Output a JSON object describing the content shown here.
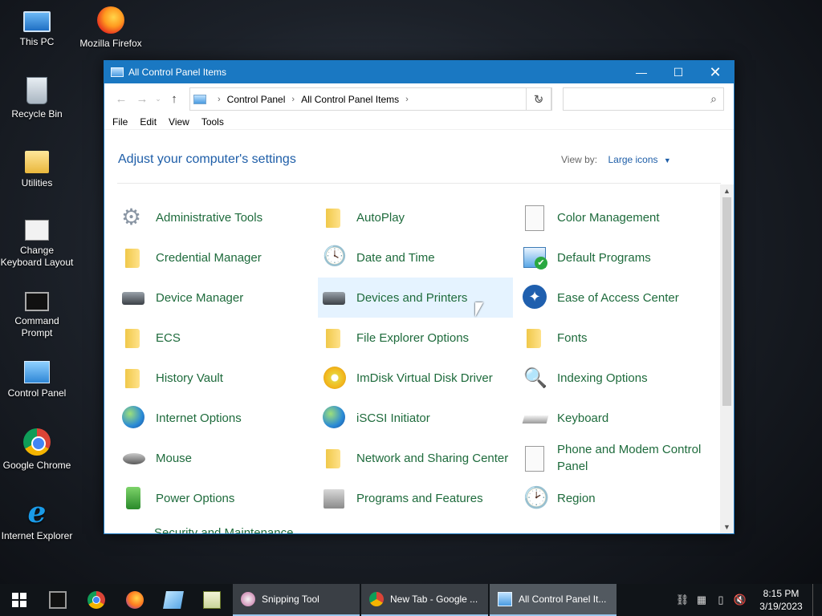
{
  "desktop": {
    "icons": [
      {
        "label": "This PC"
      },
      {
        "label": "Mozilla Firefox"
      },
      {
        "label": "Recycle Bin"
      },
      {
        "label": "Utilities"
      },
      {
        "label": "Change Keyboard Layout"
      },
      {
        "label": "Command Prompt"
      },
      {
        "label": "Control Panel"
      },
      {
        "label": "Google Chrome"
      },
      {
        "label": "Internet Explorer"
      }
    ]
  },
  "window": {
    "title": "All Control Panel Items",
    "controls": {
      "minimize": "—",
      "maximize": "☐",
      "close": "✕"
    },
    "nav": {
      "back": "←",
      "forward": "→",
      "recent": "⌄",
      "up": "↑"
    },
    "address": {
      "crumbs": [
        "Control Panel",
        "All Control Panel Items"
      ],
      "separator": "›"
    },
    "refresh": "↻",
    "search": {
      "placeholder": "",
      "icon": "⌕"
    },
    "menu": [
      "File",
      "Edit",
      "View",
      "Tools"
    ],
    "heading": "Adjust your computer's settings",
    "view_by": {
      "label": "View by:",
      "value": "Large icons",
      "caret": "▼"
    },
    "scroll": {
      "up": "▲",
      "down": "▼"
    },
    "items": [
      {
        "label": "Administrative Tools",
        "icon": "admin-tools-icon"
      },
      {
        "label": "AutoPlay",
        "icon": "autoplay-icon"
      },
      {
        "label": "Color Management",
        "icon": "color-management-icon"
      },
      {
        "label": "Credential Manager",
        "icon": "credential-manager-icon"
      },
      {
        "label": "Date and Time",
        "icon": "date-time-icon"
      },
      {
        "label": "Default Programs",
        "icon": "default-programs-icon"
      },
      {
        "label": "Device Manager",
        "icon": "device-manager-icon"
      },
      {
        "label": "Devices and Printers",
        "icon": "devices-printers-icon"
      },
      {
        "label": "Ease of Access Center",
        "icon": "ease-of-access-icon"
      },
      {
        "label": "ECS",
        "icon": "ecs-icon"
      },
      {
        "label": "File Explorer Options",
        "icon": "file-explorer-options-icon"
      },
      {
        "label": "Fonts",
        "icon": "fonts-icon"
      },
      {
        "label": "History Vault",
        "icon": "history-vault-icon"
      },
      {
        "label": "ImDisk Virtual Disk Driver",
        "icon": "imdisk-icon"
      },
      {
        "label": "Indexing Options",
        "icon": "indexing-options-icon"
      },
      {
        "label": "Internet Options",
        "icon": "internet-options-icon"
      },
      {
        "label": "iSCSI Initiator",
        "icon": "iscsi-initiator-icon"
      },
      {
        "label": "Keyboard",
        "icon": "keyboard-icon"
      },
      {
        "label": "Mouse",
        "icon": "mouse-icon"
      },
      {
        "label": "Network and Sharing Center",
        "icon": "network-sharing-icon"
      },
      {
        "label": "Phone and Modem Control Panel",
        "icon": "phone-modem-icon"
      },
      {
        "label": "Power Options",
        "icon": "power-options-icon"
      },
      {
        "label": "Programs and Features",
        "icon": "programs-features-icon"
      },
      {
        "label": "Region",
        "icon": "region-icon"
      }
    ],
    "partial_item": "Security and Maintenance"
  },
  "taskbar": {
    "tasks": [
      {
        "label": "Snipping Tool"
      },
      {
        "label": "New Tab - Google ..."
      },
      {
        "label": "All Control Panel It..."
      }
    ],
    "clock": {
      "time": "8:15 PM",
      "date": "3/19/2023"
    }
  }
}
